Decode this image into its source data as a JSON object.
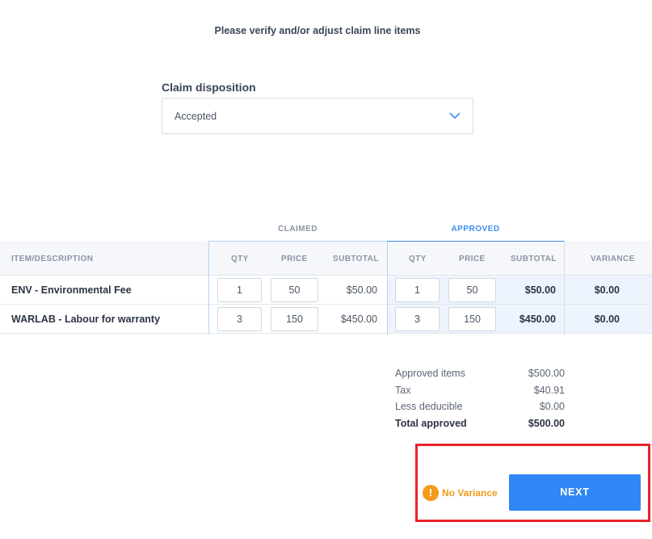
{
  "header": {
    "title": "Please verify and/or adjust claim line items"
  },
  "disposition": {
    "label": "Claim disposition",
    "value": "Accepted"
  },
  "groups": {
    "claimed": "CLAIMED",
    "approved": "APPROVED"
  },
  "columns": {
    "item": "ITEM/DESCRIPTION",
    "claimed_qty": "QTY",
    "claimed_price": "PRICE",
    "claimed_subtotal": "SUBTOTAL",
    "approved_qty": "QTY",
    "approved_price": "PRICE",
    "approved_subtotal": "SUBTOTAL",
    "variance": "VARIANCE"
  },
  "rows": [
    {
      "description": "ENV - Environmental Fee",
      "claimed_qty": "1",
      "claimed_price": "50",
      "claimed_subtotal": "$50.00",
      "approved_qty": "1",
      "approved_price": "50",
      "approved_subtotal": "$50.00",
      "variance": "$0.00"
    },
    {
      "description": "WARLAB - Labour for warranty",
      "claimed_qty": "3",
      "claimed_price": "150",
      "claimed_subtotal": "$450.00",
      "approved_qty": "3",
      "approved_price": "150",
      "approved_subtotal": "$450.00",
      "variance": "$0.00"
    }
  ],
  "totals": [
    {
      "label": "Approved items",
      "amount": "$500.00"
    },
    {
      "label": "Tax",
      "amount": "$40.91"
    },
    {
      "label": "Less deducible",
      "amount": "$0.00"
    },
    {
      "label": "Total approved",
      "amount": "$500.00"
    }
  ],
  "footer": {
    "variance_status": "No Variance",
    "warning_glyph": "!",
    "next_label": "NEXT"
  },
  "colors": {
    "accent": "#2f86f6",
    "warning": "#f39a1e",
    "highlight": "#e8232a"
  },
  "icons": {
    "dropdown": "chevron-down-icon",
    "status": "warning-icon"
  }
}
